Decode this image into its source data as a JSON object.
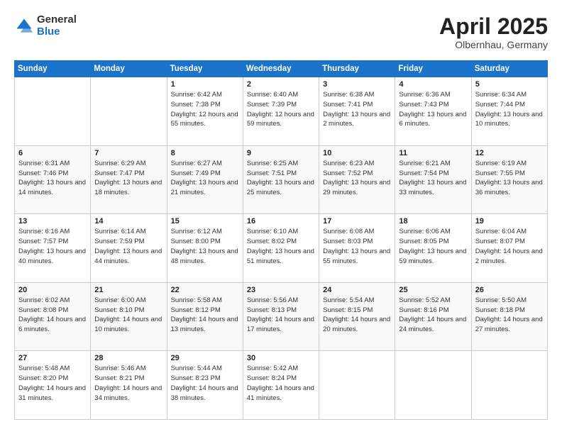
{
  "logo": {
    "general": "General",
    "blue": "Blue"
  },
  "header": {
    "month_year": "April 2025",
    "location": "Olbernhau, Germany"
  },
  "weekdays": [
    "Sunday",
    "Monday",
    "Tuesday",
    "Wednesday",
    "Thursday",
    "Friday",
    "Saturday"
  ],
  "weeks": [
    [
      {
        "day": "",
        "sunrise": "",
        "sunset": "",
        "daylight": ""
      },
      {
        "day": "",
        "sunrise": "",
        "sunset": "",
        "daylight": ""
      },
      {
        "day": "1",
        "sunrise": "Sunrise: 6:42 AM",
        "sunset": "Sunset: 7:38 PM",
        "daylight": "Daylight: 12 hours and 55 minutes."
      },
      {
        "day": "2",
        "sunrise": "Sunrise: 6:40 AM",
        "sunset": "Sunset: 7:39 PM",
        "daylight": "Daylight: 12 hours and 59 minutes."
      },
      {
        "day": "3",
        "sunrise": "Sunrise: 6:38 AM",
        "sunset": "Sunset: 7:41 PM",
        "daylight": "Daylight: 13 hours and 2 minutes."
      },
      {
        "day": "4",
        "sunrise": "Sunrise: 6:36 AM",
        "sunset": "Sunset: 7:43 PM",
        "daylight": "Daylight: 13 hours and 6 minutes."
      },
      {
        "day": "5",
        "sunrise": "Sunrise: 6:34 AM",
        "sunset": "Sunset: 7:44 PM",
        "daylight": "Daylight: 13 hours and 10 minutes."
      }
    ],
    [
      {
        "day": "6",
        "sunrise": "Sunrise: 6:31 AM",
        "sunset": "Sunset: 7:46 PM",
        "daylight": "Daylight: 13 hours and 14 minutes."
      },
      {
        "day": "7",
        "sunrise": "Sunrise: 6:29 AM",
        "sunset": "Sunset: 7:47 PM",
        "daylight": "Daylight: 13 hours and 18 minutes."
      },
      {
        "day": "8",
        "sunrise": "Sunrise: 6:27 AM",
        "sunset": "Sunset: 7:49 PM",
        "daylight": "Daylight: 13 hours and 21 minutes."
      },
      {
        "day": "9",
        "sunrise": "Sunrise: 6:25 AM",
        "sunset": "Sunset: 7:51 PM",
        "daylight": "Daylight: 13 hours and 25 minutes."
      },
      {
        "day": "10",
        "sunrise": "Sunrise: 6:23 AM",
        "sunset": "Sunset: 7:52 PM",
        "daylight": "Daylight: 13 hours and 29 minutes."
      },
      {
        "day": "11",
        "sunrise": "Sunrise: 6:21 AM",
        "sunset": "Sunset: 7:54 PM",
        "daylight": "Daylight: 13 hours and 33 minutes."
      },
      {
        "day": "12",
        "sunrise": "Sunrise: 6:19 AM",
        "sunset": "Sunset: 7:55 PM",
        "daylight": "Daylight: 13 hours and 36 minutes."
      }
    ],
    [
      {
        "day": "13",
        "sunrise": "Sunrise: 6:16 AM",
        "sunset": "Sunset: 7:57 PM",
        "daylight": "Daylight: 13 hours and 40 minutes."
      },
      {
        "day": "14",
        "sunrise": "Sunrise: 6:14 AM",
        "sunset": "Sunset: 7:59 PM",
        "daylight": "Daylight: 13 hours and 44 minutes."
      },
      {
        "day": "15",
        "sunrise": "Sunrise: 6:12 AM",
        "sunset": "Sunset: 8:00 PM",
        "daylight": "Daylight: 13 hours and 48 minutes."
      },
      {
        "day": "16",
        "sunrise": "Sunrise: 6:10 AM",
        "sunset": "Sunset: 8:02 PM",
        "daylight": "Daylight: 13 hours and 51 minutes."
      },
      {
        "day": "17",
        "sunrise": "Sunrise: 6:08 AM",
        "sunset": "Sunset: 8:03 PM",
        "daylight": "Daylight: 13 hours and 55 minutes."
      },
      {
        "day": "18",
        "sunrise": "Sunrise: 6:06 AM",
        "sunset": "Sunset: 8:05 PM",
        "daylight": "Daylight: 13 hours and 59 minutes."
      },
      {
        "day": "19",
        "sunrise": "Sunrise: 6:04 AM",
        "sunset": "Sunset: 8:07 PM",
        "daylight": "Daylight: 14 hours and 2 minutes."
      }
    ],
    [
      {
        "day": "20",
        "sunrise": "Sunrise: 6:02 AM",
        "sunset": "Sunset: 8:08 PM",
        "daylight": "Daylight: 14 hours and 6 minutes."
      },
      {
        "day": "21",
        "sunrise": "Sunrise: 6:00 AM",
        "sunset": "Sunset: 8:10 PM",
        "daylight": "Daylight: 14 hours and 10 minutes."
      },
      {
        "day": "22",
        "sunrise": "Sunrise: 5:58 AM",
        "sunset": "Sunset: 8:12 PM",
        "daylight": "Daylight: 14 hours and 13 minutes."
      },
      {
        "day": "23",
        "sunrise": "Sunrise: 5:56 AM",
        "sunset": "Sunset: 8:13 PM",
        "daylight": "Daylight: 14 hours and 17 minutes."
      },
      {
        "day": "24",
        "sunrise": "Sunrise: 5:54 AM",
        "sunset": "Sunset: 8:15 PM",
        "daylight": "Daylight: 14 hours and 20 minutes."
      },
      {
        "day": "25",
        "sunrise": "Sunrise: 5:52 AM",
        "sunset": "Sunset: 8:16 PM",
        "daylight": "Daylight: 14 hours and 24 minutes."
      },
      {
        "day": "26",
        "sunrise": "Sunrise: 5:50 AM",
        "sunset": "Sunset: 8:18 PM",
        "daylight": "Daylight: 14 hours and 27 minutes."
      }
    ],
    [
      {
        "day": "27",
        "sunrise": "Sunrise: 5:48 AM",
        "sunset": "Sunset: 8:20 PM",
        "daylight": "Daylight: 14 hours and 31 minutes."
      },
      {
        "day": "28",
        "sunrise": "Sunrise: 5:46 AM",
        "sunset": "Sunset: 8:21 PM",
        "daylight": "Daylight: 14 hours and 34 minutes."
      },
      {
        "day": "29",
        "sunrise": "Sunrise: 5:44 AM",
        "sunset": "Sunset: 8:23 PM",
        "daylight": "Daylight: 14 hours and 38 minutes."
      },
      {
        "day": "30",
        "sunrise": "Sunrise: 5:42 AM",
        "sunset": "Sunset: 8:24 PM",
        "daylight": "Daylight: 14 hours and 41 minutes."
      },
      {
        "day": "",
        "sunrise": "",
        "sunset": "",
        "daylight": ""
      },
      {
        "day": "",
        "sunrise": "",
        "sunset": "",
        "daylight": ""
      },
      {
        "day": "",
        "sunrise": "",
        "sunset": "",
        "daylight": ""
      }
    ]
  ]
}
